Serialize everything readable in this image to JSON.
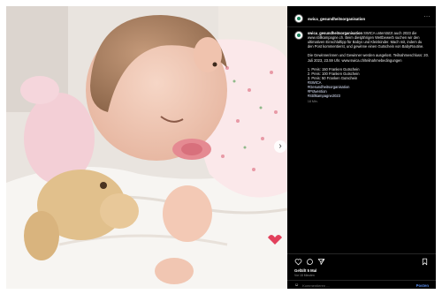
{
  "post": {
    "username": "swica_gesundheitsorganisation",
    "more_label": "···",
    "caption": {
      "username": "swica_gesundheitsorganisation",
      "text_1": "SWICA unterstützt auch 2023 die www.stillkampagne.ch. Beim diesjährigen Wettbewerb suchen wir den ultimativen Einschlaftipp für Babys und Kleinkinder. Mach mit, indem du den Post kommentierst, und gewinne einen Gutschein von BabyRoutine.",
      "text_2": "Die Gewinnerinnen und Gewinner werden ausgelost. Teilnahmeschluss: 20. Juli 2023, 23.59 Uhr. www.swica.ch/teilnahmebedingungen",
      "prizes": [
        "1. Preis: 150 Franken Gutschein",
        "2. Preis: 100 Franken Gutschein",
        "3. Preis: 50 Franken Gutschein"
      ],
      "hashtags": [
        "#SWICA",
        "#Gesundheitsorganisation",
        "#Prävention",
        "#Stillkampagne2023"
      ],
      "ago": "18 Min."
    },
    "likes": "Gefällt 5 Mal",
    "date": "Vor 18 Minuten",
    "comment_placeholder": "Kommentieren ...",
    "post_label": "Posten",
    "icons": {
      "like": "heart-icon",
      "comment": "comment-icon",
      "share": "share-icon",
      "save": "bookmark-icon",
      "emoji": "emoji-icon",
      "next": "chevron-right-icon"
    },
    "colors": {
      "background": "#000000",
      "link": "#5a8ef0"
    }
  }
}
